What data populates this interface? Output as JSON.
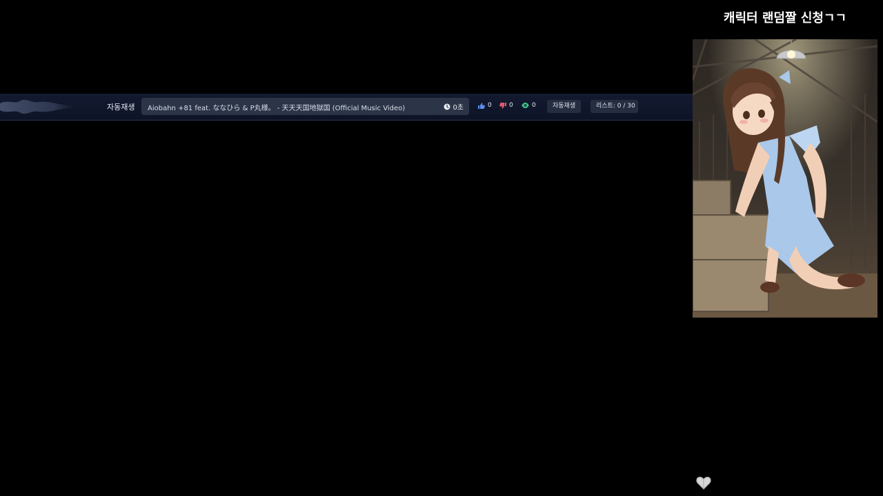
{
  "caption": {
    "text": "캐릭터 랜덤짤 신청ㄱㄱ"
  },
  "player": {
    "autoplay_label": "자동재생",
    "title": "Aiobahn +81 feat. ななひら & P丸様。 - 天天天国地獄国 (Official Music Video)",
    "duration": "0초",
    "likes": "0",
    "dislikes": "0",
    "views": "0",
    "autoplay_button": "자동재생",
    "list_counter": "리스트: 0 / 30"
  },
  "colors": {
    "bar_bg": "#131a30",
    "pill_bg": "#2c3548",
    "like": "#5b8def",
    "dislike": "#e05a6e",
    "view": "#3fc78a"
  },
  "icons": {
    "duration": "clock-icon",
    "like": "thumbs-up-icon",
    "dislike": "thumbs-down-icon",
    "views": "eye-icon",
    "bottom": "heart-icon"
  }
}
